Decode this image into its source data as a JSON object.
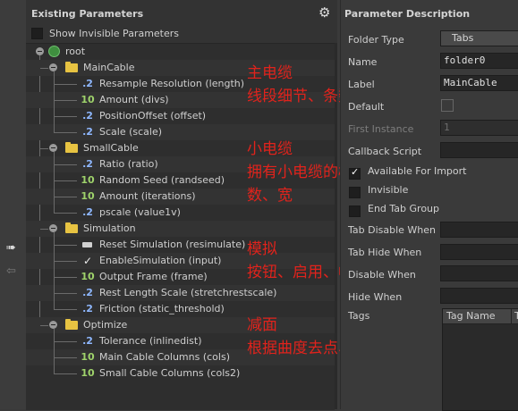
{
  "left_panel": {
    "title": "Existing Parameters",
    "show_invisible_label": "Show Invisible Parameters",
    "root_label": "root",
    "tree": [
      {
        "kind": "folder",
        "label": "MainCable"
      },
      {
        "kind": "float",
        "icon": ".2",
        "label": "Resample Resolution (length)"
      },
      {
        "kind": "int",
        "icon": "10",
        "label": "Amount (divs)"
      },
      {
        "kind": "float",
        "icon": ".2",
        "label": "PositionOffset (offset)"
      },
      {
        "kind": "float",
        "icon": ".2",
        "label": "Scale (scale)"
      },
      {
        "kind": "folder",
        "label": "SmallCable"
      },
      {
        "kind": "float",
        "icon": ".2",
        "label": "Ratio (ratio)"
      },
      {
        "kind": "int",
        "icon": "10",
        "label": "Random Seed (randseed)"
      },
      {
        "kind": "int",
        "icon": "10",
        "label": "Amount (iterations)"
      },
      {
        "kind": "float",
        "icon": ".2",
        "label": "pscale (value1v)"
      },
      {
        "kind": "folder",
        "label": "Simulation"
      },
      {
        "kind": "button",
        "icon": "",
        "label": "Reset Simulation (resimulate)"
      },
      {
        "kind": "toggle",
        "icon": "✓",
        "label": "EnableSimulation (input)"
      },
      {
        "kind": "int",
        "icon": "10",
        "label": "Output Frame (frame)"
      },
      {
        "kind": "float",
        "icon": ".2",
        "label": "Rest Length Scale (stretchrestscale)"
      },
      {
        "kind": "float",
        "icon": ".2",
        "label": "Friction (static_threshold)"
      },
      {
        "kind": "folder",
        "label": "Optimize"
      },
      {
        "kind": "float",
        "icon": ".2",
        "label": "Tolerance (inlinedist)"
      },
      {
        "kind": "int",
        "icon": "10",
        "label": "Main Cable Columns (cols)"
      },
      {
        "kind": "int",
        "icon": "10",
        "label": "Small Cable Columns (cols2)"
      }
    ]
  },
  "annotations": [
    {
      "lines": [
        "主电缆",
        "线段细节、条数、随机、宽"
      ]
    },
    {
      "lines": [
        "小电缆",
        "拥有小电缆的概率、随机、缠绕",
        "数、宽"
      ]
    },
    {
      "lines": [
        "模拟",
        "按钮、启用、帧数、伸展、摩擦"
      ]
    },
    {
      "lines": [
        "减面",
        "根据曲度去点、横截面边数"
      ]
    }
  ],
  "right_panel": {
    "title": "Parameter Description",
    "folder_type_label": "Folder Type",
    "folder_type_value": "Tabs",
    "name_label": "Name",
    "name_value": "folder0",
    "label_label": "Label",
    "label_value": "MainCable",
    "default_label": "Default",
    "first_instance_label": "First Instance",
    "first_instance_value": "1",
    "callback_label": "Callback Script",
    "available_label": "Available For Import",
    "invisible_label": "Invisible",
    "end_tab_label": "End Tab Group",
    "tab_disable_label": "Tab Disable When",
    "tab_hide_label": "Tab Hide When",
    "disable_when_label": "Disable When",
    "hide_when_label": "Hide When",
    "tags_label": "Tags",
    "tag_name_header": "Tag Name",
    "tag_col2_header": "T"
  },
  "colors": {
    "annotation": "#e0231c",
    "folder": "#e7c342",
    "float_icon": "#8fb8ff",
    "int_icon": "#9fd36b"
  },
  "icons": {
    "gear": "gear-icon",
    "left_arrow_top": "arrow-right-icon",
    "left_arrow_bottom": "arrow-left-icon"
  }
}
